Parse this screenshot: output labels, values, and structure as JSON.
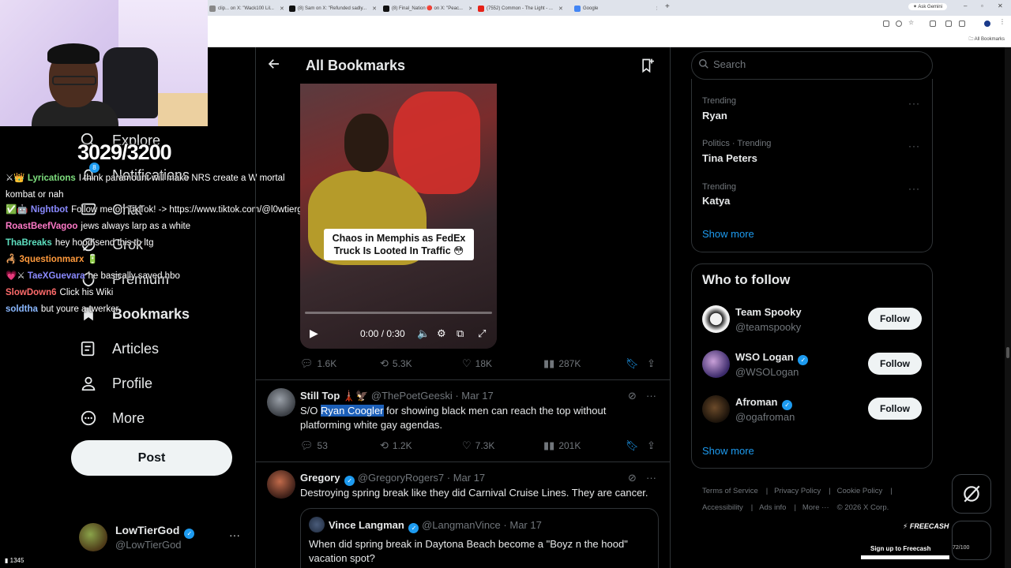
{
  "browser": {
    "tabs": [
      {
        "label": "clip... on X: \"Wack100 Lil...",
        "color": "#888888"
      },
      {
        "label": "(8) Sam on X: \"Refunded sadly...",
        "color": "#111111"
      },
      {
        "label": "(8) Final_Nation 🔴 on X: \"Peac...",
        "color": "#111111"
      },
      {
        "label": "(7552) Common - The Light - ...",
        "color": "#e62117"
      },
      {
        "label": "Google",
        "color": "#4285f4"
      }
    ],
    "new_tab": "+",
    "ask_gemini": "Ask Gemini",
    "all_bookmarks": "All Bookmarks"
  },
  "nav": {
    "explore": "Explore",
    "notifications": "Notifications",
    "notifications_badge": "8",
    "chat": "Chat",
    "grok": "Grok",
    "premium": "Premium",
    "bookmarks": "Bookmarks",
    "articles": "Articles",
    "profile": "Profile",
    "more": "More",
    "post": "Post"
  },
  "overlay_counter": "3029/3200",
  "chat": [
    {
      "user": "Lyrications",
      "color": "#7fe07f",
      "msg": "I think paramount will make NRS create a W mortal kombat or nah",
      "badge": "⚔👑"
    },
    {
      "user": "Nightbot",
      "color": "#8a8aff",
      "msg": "Follow me on TikTok! -> https://www.tiktok.com/@l0wtiergod",
      "badge": "✅🤖"
    },
    {
      "user": "RoastBeefVagoo",
      "color": "#ff7ac8",
      "msg": "jews always larp as a white"
    },
    {
      "user": "ThaBreaks",
      "color": "#5ee0c0",
      "msg": "hey hood send this to ltg"
    },
    {
      "user": "3questionmarx",
      "color": "#ff9a3c",
      "msg": "🔋",
      "badge": "🦂"
    },
    {
      "user": "TaeXGuevara",
      "color": "#8a8aff",
      "msg": "he basically saved hbo",
      "badge": "💗⚔"
    },
    {
      "user": "SlowDown6",
      "color": "#ff6b6b",
      "msg": "Click his Wiki"
    },
    {
      "user": "soldtha",
      "color": "#8ab8ff",
      "msg": "but youre a twerker"
    }
  ],
  "twitch_viewers": "1345",
  "account": {
    "name": "LowTierGod",
    "handle": "@LowTierGod"
  },
  "header": {
    "title": "All Bookmarks"
  },
  "video": {
    "caption": "Chaos in Memphis as FedEx Truck Is Looted In Traffic 😳",
    "time": "0:00 / 0:30",
    "progress": 0
  },
  "tweet1_stats": {
    "replies": "1.6K",
    "reposts": "5.3K",
    "likes": "18K",
    "views": "287K"
  },
  "tweet2": {
    "name": "Still Top 🗼🦅",
    "handle": "@ThePoetGeeski",
    "date": "· Mar 17",
    "text_before": "S/O ",
    "text_highlight": "Ryan Coogler",
    "text_after": " for showing black men can reach the top without platforming white gay agendas.",
    "replies": "53",
    "reposts": "1.2K",
    "likes": "7.3K",
    "views": "201K"
  },
  "tweet3": {
    "name": "Gregory",
    "handle": "@GregoryRogers7",
    "date": "· Mar 17",
    "text": "Destroying spring break like they did Carnival Cruise Lines. They are cancer.",
    "quote": {
      "name": "Vince Langman",
      "handle": "@LangmanVince",
      "date": "· Mar 17",
      "text": "When did spring break in Daytona Beach become a \"Boyz n the hood\" vacation spot?"
    }
  },
  "search": {
    "placeholder": "Search"
  },
  "trends": [
    {
      "context": "Trending",
      "name": "Ryan"
    },
    {
      "context": "Politics · Trending",
      "name": "Tina Peters"
    },
    {
      "context": "Trending",
      "name": "Katya"
    }
  ],
  "trends_show_more": "Show more",
  "who_to_follow": {
    "title": "Who to follow",
    "accounts": [
      {
        "name": "Team Spooky",
        "handle": "@teamspooky",
        "verified": false,
        "button": "Follow"
      },
      {
        "name": "WSO Logan",
        "handle": "@WSOLogan",
        "verified": true,
        "button": "Follow"
      },
      {
        "name": "Afroman",
        "handle": "@ogafroman",
        "verified": true,
        "button": "Follow"
      }
    ],
    "show_more": "Show more"
  },
  "footer": {
    "terms": "Terms of Service",
    "privacy": "Privacy Policy",
    "cookie": "Cookie Policy",
    "accessibility": "Accessibility",
    "ads": "Ads info",
    "more": "More ···",
    "copyright": "© 2026 X Corp."
  },
  "freecash": {
    "brand": "FREECASH",
    "cta": "Sign up to Freecash",
    "progress_text": "72/100"
  },
  "colors": {
    "accent": "#1d9bf0",
    "bg": "#000000",
    "border": "#2f3336",
    "muted": "#71767b"
  }
}
